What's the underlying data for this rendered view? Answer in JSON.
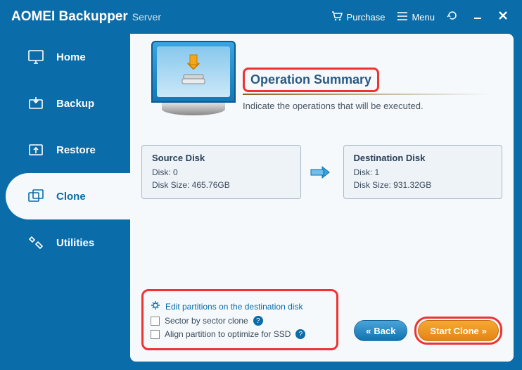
{
  "brand": {
    "main": "AOMEI Backupper",
    "sub": "Server"
  },
  "header": {
    "purchase": "Purchase",
    "menu": "Menu"
  },
  "sidebar": {
    "items": [
      {
        "label": "Home"
      },
      {
        "label": "Backup"
      },
      {
        "label": "Restore"
      },
      {
        "label": "Clone"
      },
      {
        "label": "Utilities"
      }
    ]
  },
  "summary": {
    "title": "Operation Summary",
    "subtitle": "Indicate the operations that will be executed."
  },
  "source": {
    "heading": "Source Disk",
    "disk_label": "Disk: 0",
    "size_label": "Disk Size: 465.76GB"
  },
  "destination": {
    "heading": "Destination Disk",
    "disk_label": "Disk: 1",
    "size_label": "Disk Size: 931.32GB"
  },
  "options": {
    "edit_partitions": "Edit partitions on the destination disk",
    "sector_clone": "Sector by sector clone",
    "align_ssd": "Align partition to optimize for SSD"
  },
  "buttons": {
    "back": "Back",
    "start": "Start Clone"
  },
  "colors": {
    "primary": "#0a6ca8",
    "accent": "#e38518",
    "highlight_border": "#e33"
  }
}
